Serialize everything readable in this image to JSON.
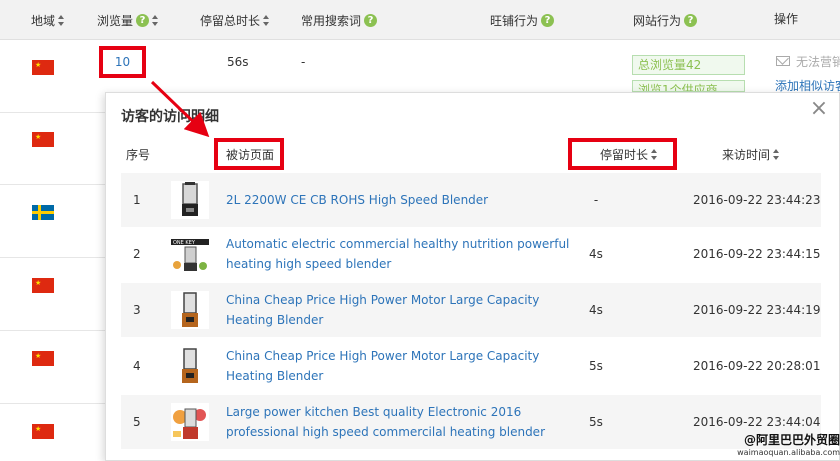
{
  "table": {
    "headers": {
      "region": "地域",
      "views": "浏览量",
      "stay": "停留总时长",
      "search": "常用搜索词",
      "wangpu": "旺铺行为",
      "website": "网站行为",
      "operation": "操作"
    },
    "first_row": {
      "views": "10",
      "stay": "56s",
      "search": "-",
      "site_tag_1": "总浏览量42",
      "site_tag_2": "浏览1个供应商",
      "op_text": "无法营销",
      "op_link": "添加相似访客"
    }
  },
  "popup": {
    "title": "访客的访问明细",
    "close": "×",
    "columns": {
      "index": "序号",
      "page": "被访页面",
      "stay": "停留时长",
      "time": "来访时间"
    },
    "rows": [
      {
        "index": "1",
        "title": "2L 2200W CE CB ROHS High Speed Blender",
        "stay": "-",
        "time": "2016-09-22 23:44:23"
      },
      {
        "index": "2",
        "title": "Automatic electric commercial healthy nutrition powerful heating high speed blender",
        "stay": "4s",
        "time": "2016-09-22 23:44:15"
      },
      {
        "index": "3",
        "title": "China Cheap Price High Power Motor Large Capacity Heating Blender",
        "stay": "4s",
        "time": "2016-09-22 23:44:19"
      },
      {
        "index": "4",
        "title": "China Cheap Price High Power Motor Large Capacity Heating Blender",
        "stay": "5s",
        "time": "2016-09-22 20:28:01"
      },
      {
        "index": "5",
        "title": "Large power kitchen Best quality Electronic 2016 professional high speed commercilal heating blender",
        "stay": "5s",
        "time": "2016-09-22 23:44:04"
      }
    ]
  },
  "watermark": {
    "line1": "@阿里巴巴外贸圈",
    "line2": "waimaoquan.alibaba.com"
  },
  "colors": {
    "link": "#2d74b9",
    "annotation": "#e60012",
    "help_icon": "#8cc152"
  }
}
